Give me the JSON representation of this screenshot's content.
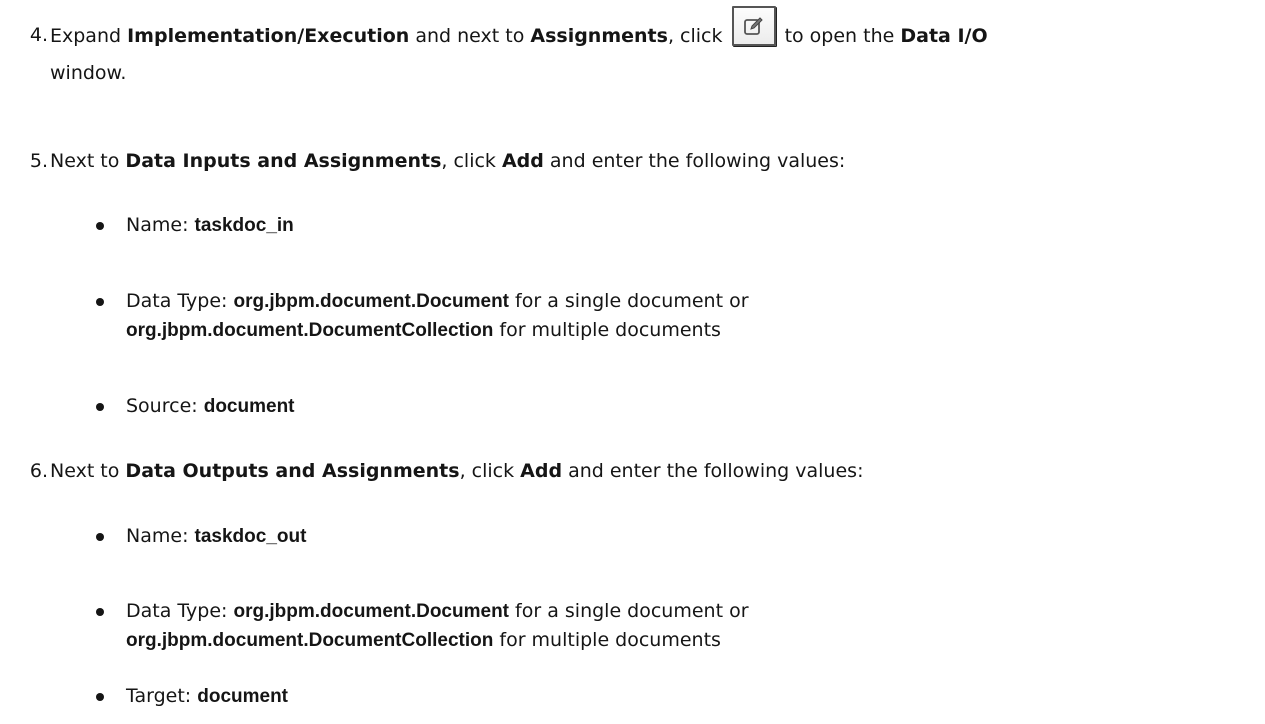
{
  "steps": [
    {
      "number": "4.",
      "parts": {
        "a": "Expand ",
        "b": "Implementation/Execution",
        "c": " and next to ",
        "d": "Assignments",
        "e": ", click ",
        "f": " to open the ",
        "g": "Data I/O",
        "h": "window."
      },
      "icon": "edit-icon"
    },
    {
      "number": "5.",
      "parts": {
        "a": "Next to ",
        "b": "Data Inputs and Assignments",
        "c": ", click ",
        "d": "Add",
        "e": " and enter the following values:"
      },
      "bullets": [
        {
          "label": "Name",
          "sep": ": ",
          "value": "taskdoc_in",
          "rest": "",
          "value2": "",
          "rest2": ""
        },
        {
          "label": "Data Type",
          "sep": ": ",
          "value": "org.jbpm.document.Document",
          "rest": " for a single document or",
          "value2": "org.jbpm.document.DocumentCollection",
          "rest2": " for multiple documents"
        },
        {
          "label": "Source",
          "sep": ": ",
          "value": "document",
          "rest": "",
          "value2": "",
          "rest2": ""
        }
      ]
    },
    {
      "number": "6.",
      "parts": {
        "a": "Next to ",
        "b": "Data Outputs and Assignments",
        "c": ", click ",
        "d": "Add",
        "e": " and enter the following values:"
      },
      "bullets": [
        {
          "label": "Name",
          "sep": ": ",
          "value": "taskdoc_out",
          "rest": "",
          "value2": "",
          "rest2": ""
        },
        {
          "label": "Data Type",
          "sep": ": ",
          "value": "org.jbpm.document.Document",
          "rest": " for a single document or",
          "value2": "org.jbpm.document.DocumentCollection",
          "rest2": " for multiple documents"
        },
        {
          "label": "Target",
          "sep": ": ",
          "value": "document",
          "rest": "",
          "value2": "",
          "rest2": ""
        }
      ]
    }
  ]
}
